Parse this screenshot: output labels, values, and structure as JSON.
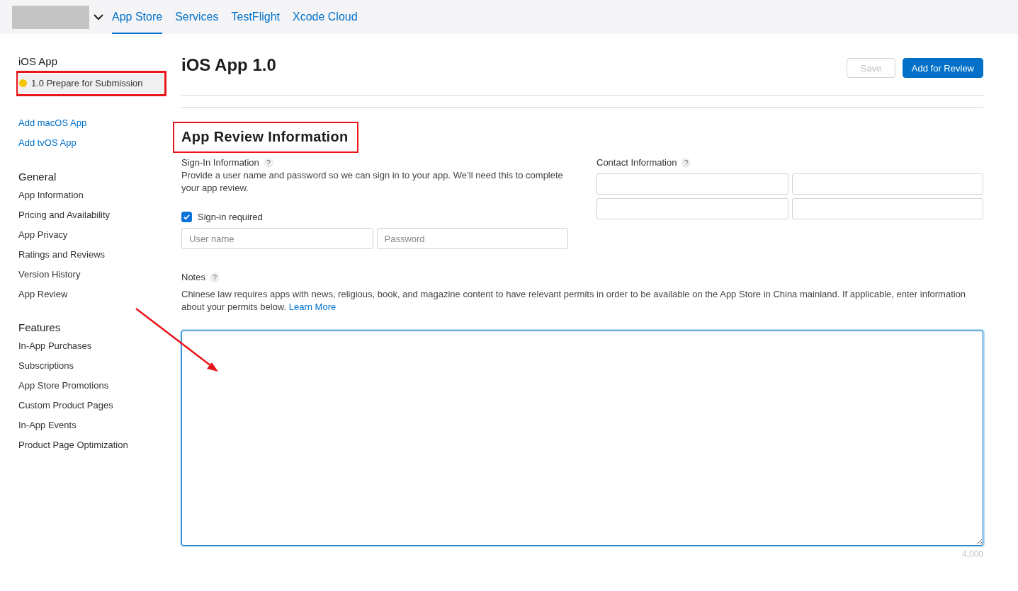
{
  "top_bar": {
    "tabs": [
      {
        "label": "App Store",
        "selected": true
      },
      {
        "label": "Services",
        "selected": false
      },
      {
        "label": "TestFlight",
        "selected": false
      },
      {
        "label": "Xcode Cloud",
        "selected": false
      }
    ]
  },
  "sidebar": {
    "platform": "iOS App",
    "versions": [
      {
        "label": "1.0 Prepare for Submission",
        "selected": true,
        "color": "#f5c400",
        "annotated": true
      }
    ],
    "add_links": [
      "Add macOS App",
      "Add tvOS App"
    ],
    "sections": [
      {
        "title": "General",
        "items": [
          "App Information",
          "Pricing and Availability",
          "App Privacy",
          "Ratings and Reviews",
          "Version History",
          "App Review"
        ]
      },
      {
        "title": "Features",
        "items": [
          "In-App Purchases",
          "Subscriptions",
          "App Store Promotions",
          "Custom Product Pages",
          "In-App Events",
          "Product Page Optimization"
        ]
      }
    ]
  },
  "header": {
    "title": "iOS App 1.0",
    "buttons": [
      {
        "label": "Save",
        "kind": "secondary",
        "disabled": true
      },
      {
        "label": "Add for Review",
        "kind": "primary",
        "disabled": false
      }
    ]
  },
  "section": {
    "title": "App Review Information",
    "annotated": true,
    "sign_in": {
      "label": "Sign-In Information",
      "help": "?",
      "description": "Provide a user name and password so we can sign in to your app. We’ll need this to complete your app review.",
      "required": {
        "label": "Sign-in required",
        "checked": true
      },
      "fields": [
        {
          "placeholder": "User name"
        },
        {
          "placeholder": "Password"
        }
      ]
    },
    "contact": {
      "label": "Contact Information",
      "help": "?"
    },
    "notes": {
      "label": "Notes",
      "help": "?",
      "description": "Chinese law requires apps with news, religious, book, and magazine content to have relevant permits in order to be available on the App Store in China mainland. If applicable, enter information about your permits below.",
      "link": "Learn More",
      "focused": true,
      "counter": "4,000"
    }
  }
}
